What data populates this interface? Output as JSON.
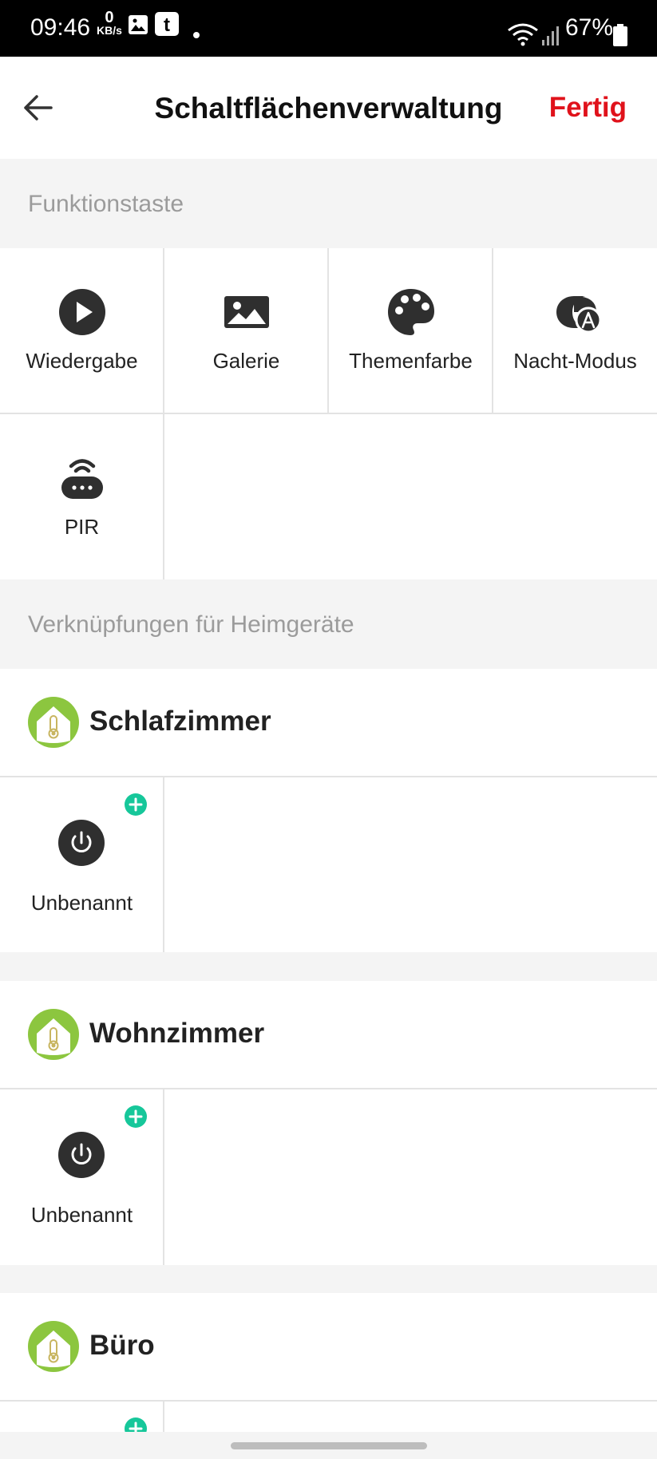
{
  "status_bar": {
    "time": "09:46",
    "net_speed_value": "0",
    "net_speed_unit": "KB/s",
    "battery": "67%"
  },
  "header": {
    "title": "Schaltflächenverwaltung",
    "done_label": "Fertig"
  },
  "sections": {
    "function_keys": "Funktionstaste",
    "shortcuts": "Verknüpfungen für Heimgeräte"
  },
  "function_keys": [
    {
      "label": "Wiedergabe",
      "icon": "play-icon"
    },
    {
      "label": "Galerie",
      "icon": "image-icon"
    },
    {
      "label": "Themenfarbe",
      "icon": "palette-icon"
    },
    {
      "label": "Nacht-Modus",
      "icon": "night-mode-icon"
    },
    {
      "label": "PIR",
      "icon": "pir-sensor-icon"
    }
  ],
  "rooms": [
    {
      "name": "Schlafzimmer",
      "devices": [
        {
          "label": "Unbenannt"
        }
      ]
    },
    {
      "name": "Wohnzimmer",
      "devices": [
        {
          "label": "Unbenannt"
        }
      ]
    },
    {
      "name": "Büro",
      "devices": []
    }
  ],
  "colors": {
    "accent": "#e0121b",
    "add_badge": "#16c79a",
    "room_icon": "#8cc63f",
    "icon_dark": "#2f2f2f"
  }
}
